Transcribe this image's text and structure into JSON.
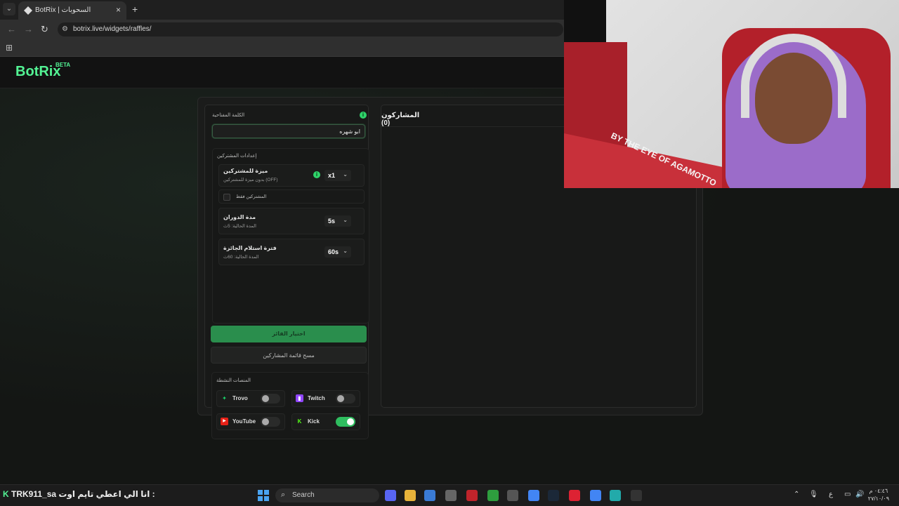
{
  "browser": {
    "tab_title": "BotRix | السحوبات",
    "tab_close": "×",
    "new_tab": "+",
    "url": "botrix.live/widgets/raffles/"
  },
  "header": {
    "logo": "BotRix",
    "beta": "BETA"
  },
  "raffle": {
    "keyword_label": "الكلمة المفتاحية",
    "keyword_value": "ابو شهره",
    "settings_label": "إعدادات المشتركين",
    "sub_advantage": {
      "title": "ميزة للمشتركين",
      "subtitle": "بدون ميزة للمشتركين (OFF)",
      "value": "x1"
    },
    "subs_only_label": "المشتركين فقط",
    "spin_duration": {
      "title": "مدة الدوران",
      "subtitle": "المدة الحالية: 5ث",
      "value": "5s"
    },
    "claim_time": {
      "title": "فترة استلام الجائزة",
      "subtitle": "المدة الحالية: 60ث",
      "value": "60s"
    },
    "pick_winner": "اختيار الفائز",
    "clear_list": "مسح قائمة المشاركين",
    "platforms_label": "المنصات النشطة",
    "platforms": [
      {
        "name": "Trovo",
        "enabled": false
      },
      {
        "name": "Twitch",
        "enabled": false
      },
      {
        "name": "YouTube",
        "enabled": false
      },
      {
        "name": "Kick",
        "enabled": true
      }
    ],
    "participants_title": "المشاركون (0)"
  },
  "webcam": {
    "pad_text": "BY THE EYE OF AGAMOTTO"
  },
  "taskbar": {
    "ticker_user": "TRK911_sa",
    "ticker_text": "انا الي اعطي تايم اوت :",
    "search_placeholder": "Search",
    "lang": "ع",
    "time": "٠٤:٤٦ م",
    "date": "٢٧/١٠/٠٩"
  },
  "colors": {
    "accent": "#53f394",
    "button": "#2a8e4d",
    "toggle_on": "#2fbd5f"
  }
}
